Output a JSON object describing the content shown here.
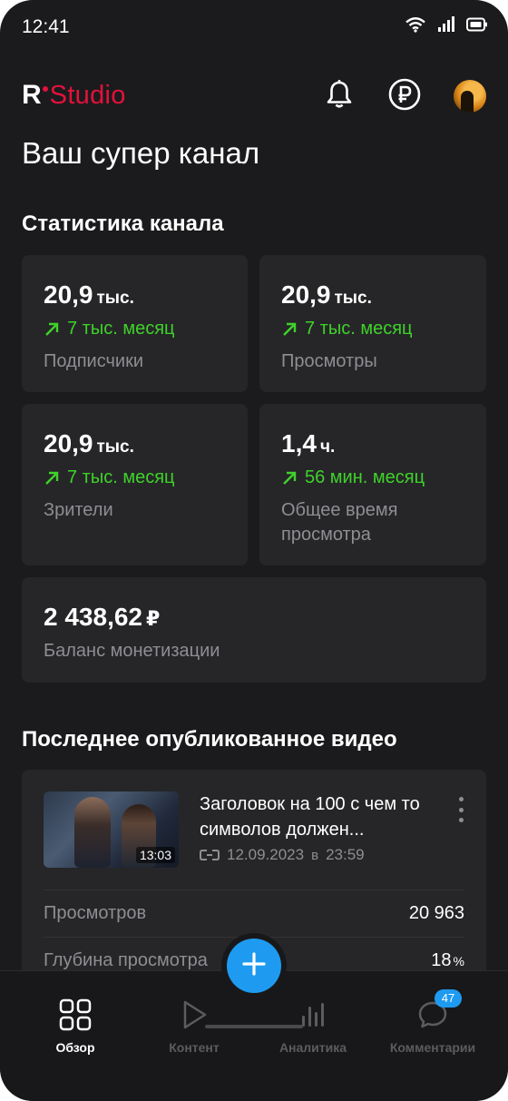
{
  "status_bar": {
    "time": "12:41"
  },
  "brand": {
    "logo_r": "R",
    "logo_studio": "Studio",
    "accent": "#e4113c"
  },
  "header": {
    "icons": [
      "bell-icon",
      "ruble-icon",
      "avatar"
    ]
  },
  "page_title": "Ваш супер канал",
  "stats": {
    "title": "Статистика канала",
    "cards": [
      {
        "value": "20,9",
        "unit": "тыс.",
        "change": "7 тыс. месяц",
        "label": "Подписчики"
      },
      {
        "value": "20,9",
        "unit": "тыс.",
        "change": "7 тыс. месяц",
        "label": "Просмотры"
      },
      {
        "value": "20,9",
        "unit": "тыс.",
        "change": "7 тыс. месяц",
        "label": "Зрители"
      },
      {
        "value": "1,4",
        "unit": "ч.",
        "change": "56 мин. месяц",
        "label": "Общее время просмотра"
      }
    ],
    "balance": {
      "value": "2 438,62",
      "unit": "₽",
      "label": "Баланс монетизации"
    }
  },
  "latest_video": {
    "title": "Последнее опубликованное видео",
    "video_title": "Заголовок на 100 с чем то символов должен...",
    "duration": "13:03",
    "date": "12.09.2023",
    "at": "в",
    "time": "23:59",
    "metrics": [
      {
        "label": "Просмотров",
        "value": "20 963",
        "unit": ""
      },
      {
        "label": "Глубина просмотра",
        "value": "18",
        "unit": "%"
      }
    ]
  },
  "bottom_nav": {
    "items": [
      {
        "label": "Обзор",
        "active": true
      },
      {
        "label": "Контент",
        "active": false
      },
      {
        "label": "Аналитика",
        "active": false
      },
      {
        "label": "Комментарии",
        "active": false,
        "badge": "47"
      }
    ]
  },
  "colors": {
    "background": "#1b1b1d",
    "card": "#262628",
    "positive": "#3fd22a",
    "primary": "#1e9bf0",
    "muted": "#8e8e93"
  }
}
